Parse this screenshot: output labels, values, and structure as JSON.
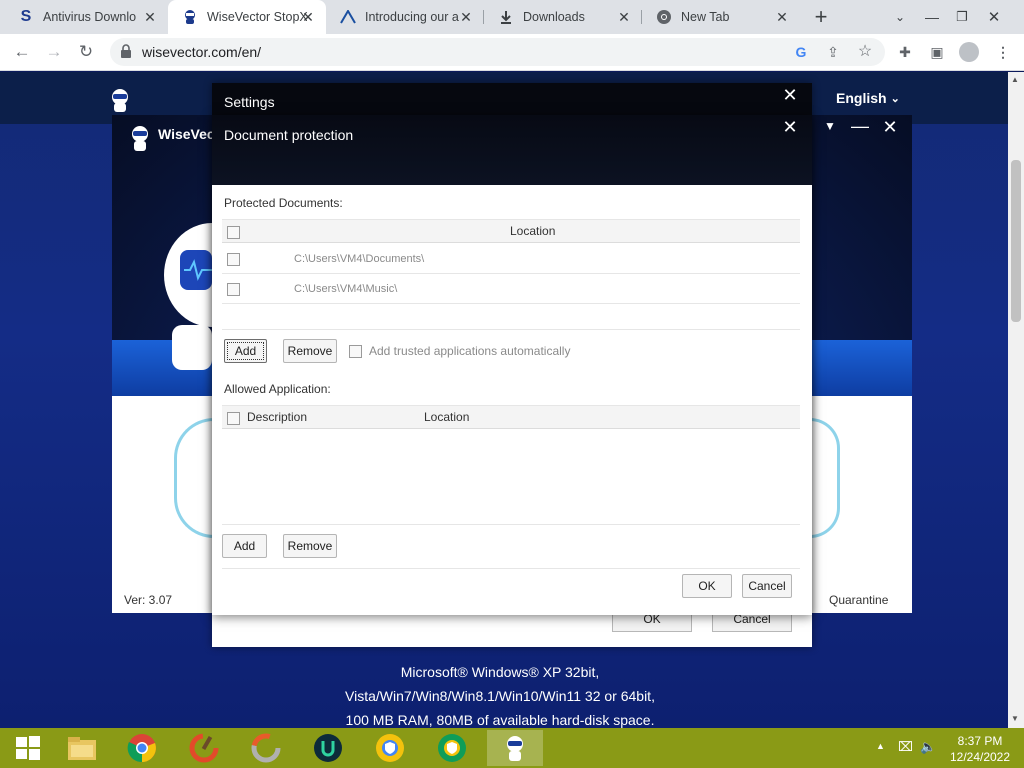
{
  "browser": {
    "tabs": [
      {
        "label": "Antivirus Downlo",
        "icon": "s-logo-icon"
      },
      {
        "label": "WiseVector StopX",
        "icon": "wisevector-icon"
      },
      {
        "label": "Introducing our a",
        "icon": "a-logo-icon"
      },
      {
        "label": "Downloads",
        "icon": "download-icon"
      },
      {
        "label": "New Tab",
        "icon": "chrome-icon"
      }
    ],
    "url": "wisevector.com/en/"
  },
  "page": {
    "language": "English",
    "requirements": [
      "Microsoft® Windows® XP 32bit,",
      "Vista/Win7/Win8/Win8.1/Win10/Win11 32 or 64bit,",
      "100 MB RAM, 80MB of available hard-disk space."
    ]
  },
  "app": {
    "title": "WiseVec",
    "version": "Ver: 3.07",
    "quarantine": "Quarantine"
  },
  "settings_dialog": {
    "title": "Settings",
    "ok": "OK",
    "cancel": "Cancel"
  },
  "doc_protection": {
    "title": "Document protection",
    "protected_label": "Protected Documents:",
    "location_header": "Location",
    "documents": [
      "C:\\Users\\VM4\\Documents\\",
      "C:\\Users\\VM4\\Music\\"
    ],
    "add": "Add",
    "remove": "Remove",
    "auto_trust": "Add trusted applications automatically",
    "allowed_label": "Allowed Application:",
    "description_header": "Description",
    "location_header2": "Location",
    "add2": "Add",
    "remove2": "Remove",
    "ok": "OK",
    "cancel": "Cancel"
  },
  "taskbar": {
    "time": "8:37 PM",
    "date": "12/24/2022"
  },
  "colors": {
    "taskbar": "#8a9a16",
    "page_bg": "#142c86"
  }
}
